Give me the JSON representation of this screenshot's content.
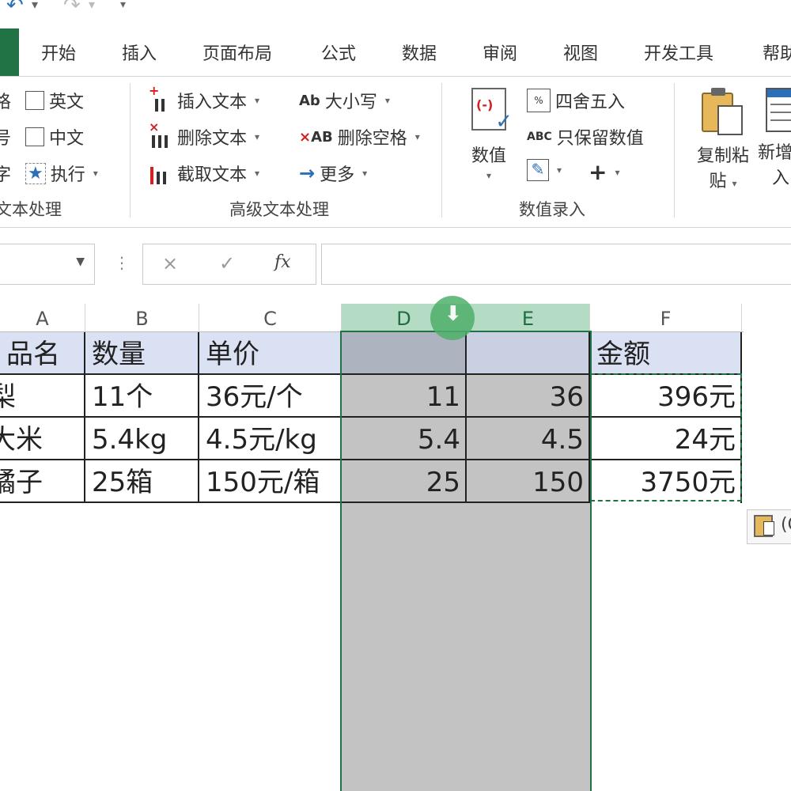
{
  "tabs": [
    "开始",
    "插入",
    "页面布局",
    "公式",
    "数据",
    "审阅",
    "视图",
    "开发工具",
    "帮助"
  ],
  "ribbon": {
    "group1": {
      "partial_left": [
        "格",
        "号",
        "字"
      ],
      "items": [
        "英文",
        "中文",
        "执行"
      ],
      "label": "文本处理"
    },
    "group2": {
      "items": [
        "插入文本",
        "删除文本",
        "截取文本"
      ],
      "col2": [
        "大小写",
        "删除空格",
        "更多"
      ],
      "label": "高级文本处理",
      "icon_ab": "Ab",
      "icon_ab2": "AB"
    },
    "group3": {
      "big_label": "数值",
      "items": [
        "四舍五入",
        "只保留数值"
      ],
      "icon_abc": "ABC",
      "label": "数值录入",
      "plus": "+"
    },
    "group4": {
      "copy_paste": "复制粘",
      "copy_paste2": "贴",
      "new_insert": "新增",
      "new_insert2": "入"
    }
  },
  "formula_bar": {
    "cancel": "×",
    "confirm": "✓",
    "fx": "fx"
  },
  "columns": [
    "A",
    "B",
    "C",
    "D",
    "E",
    "F"
  ],
  "headers": [
    "品名",
    "数量",
    "单价",
    "",
    "",
    "金额"
  ],
  "rows": [
    [
      "梨",
      "11个",
      "36元/个",
      "11",
      "36",
      "396元"
    ],
    [
      "大米",
      "5.4kg",
      "4.5元/kg",
      "5.4",
      "4.5",
      "24元"
    ],
    [
      "橘子",
      "25箱",
      "150元/箱",
      "25",
      "150",
      "3750元"
    ]
  ],
  "paste_options": "(Ctrl)",
  "icons": {
    "undo": "undo-icon",
    "redo": "redo-icon",
    "drag": "drag-arrow-icon",
    "paste": "paste-options-icon"
  },
  "colors": {
    "accent": "#217346",
    "header_fill": "#dae1f3",
    "selection": "#c3c3c3"
  }
}
